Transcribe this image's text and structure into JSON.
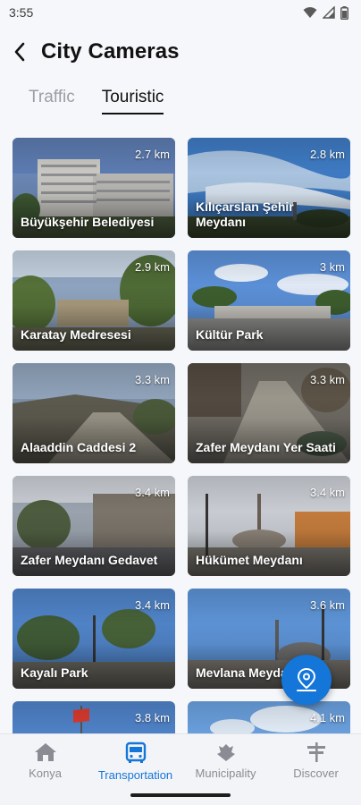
{
  "status_bar": {
    "time": "3:55"
  },
  "header": {
    "title": "City Cameras"
  },
  "tabs": [
    {
      "label": "Traffic",
      "active": false
    },
    {
      "label": "Touristic",
      "active": true
    }
  ],
  "cameras": [
    {
      "name": "Büyükşehir Belediyesi",
      "distance": "2.7 km"
    },
    {
      "name": "Kılıçarslan Şehir Meydanı",
      "distance": "2.8 km"
    },
    {
      "name": "Karatay Medresesi",
      "distance": "2.9 km"
    },
    {
      "name": "Kültür Park",
      "distance": "3 km"
    },
    {
      "name": "Alaaddin Caddesi 2",
      "distance": "3.3 km"
    },
    {
      "name": "Zafer Meydanı Yer Saati",
      "distance": "3.3 km"
    },
    {
      "name": "Zafer Meydanı Gedavet",
      "distance": "3.4 km"
    },
    {
      "name": "Hükümet Meydanı",
      "distance": "3.4 km"
    },
    {
      "name": "Kayalı Park",
      "distance": "3.4 km"
    },
    {
      "name": "Mevlana Meydanı",
      "distance": "3.6 km"
    },
    {
      "name": "",
      "distance": "3.8 km"
    },
    {
      "name": "",
      "distance": "4.1 km"
    }
  ],
  "fab": {
    "icon": "map-pin-icon"
  },
  "bottom_nav": [
    {
      "label": "Konya",
      "icon": "home-icon",
      "active": false
    },
    {
      "label": "Transportation",
      "icon": "bus-icon",
      "active": true
    },
    {
      "label": "Municipality",
      "icon": "municipality-icon",
      "active": false
    },
    {
      "label": "Discover",
      "icon": "signpost-icon",
      "active": false
    }
  ],
  "colors": {
    "accent": "#1476d8",
    "background": "#f6f7fa",
    "inactive": "#8a8c93"
  }
}
